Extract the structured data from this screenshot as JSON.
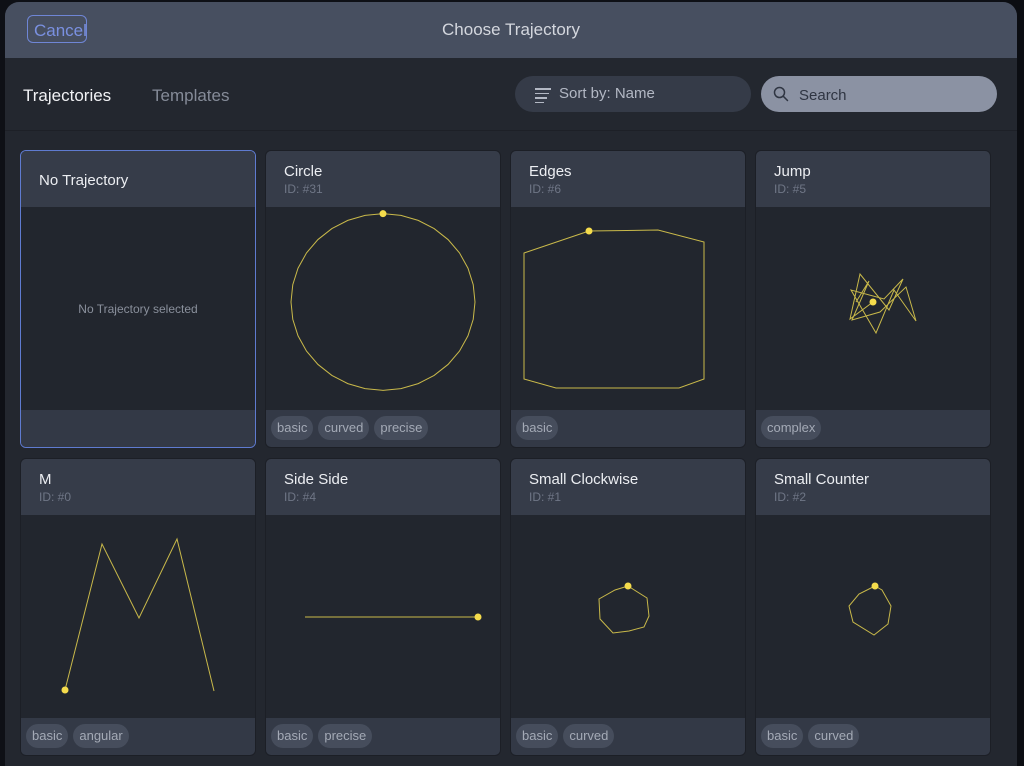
{
  "modal": {
    "title": "Choose Trajectory",
    "cancel_label": "Cancel"
  },
  "tabs": [
    {
      "label": "Trajectories",
      "active": true
    },
    {
      "label": "Templates",
      "active": false
    }
  ],
  "sort": {
    "icon": "sort-lines-icon",
    "label": "Sort by: Name"
  },
  "search": {
    "icon": "search-icon",
    "placeholder": "Search",
    "value": ""
  },
  "colors": {
    "accent": "#6f86d6",
    "trajectory_line": "#c9b94a",
    "trajectory_start": "#f5dc4c"
  },
  "cards": [
    {
      "name": "No Trajectory",
      "id": "",
      "selected": true,
      "empty_message": "No Trajectory selected",
      "tags": [],
      "shape": null
    },
    {
      "name": "Circle",
      "id": "ID: #31",
      "selected": false,
      "tags": [
        "basic",
        "curved",
        "precise"
      ],
      "shape": "circle"
    },
    {
      "name": "Edges",
      "id": "ID: #6",
      "selected": false,
      "tags": [
        "basic"
      ],
      "shape": "edges"
    },
    {
      "name": "Jump",
      "id": "ID: #5",
      "selected": false,
      "tags": [
        "complex"
      ],
      "shape": "jump"
    },
    {
      "name": "M",
      "id": "ID: #0",
      "selected": false,
      "tags": [
        "basic",
        "angular"
      ],
      "shape": "m"
    },
    {
      "name": "Side Side",
      "id": "ID: #4",
      "selected": false,
      "tags": [
        "basic",
        "precise"
      ],
      "shape": "side"
    },
    {
      "name": "Small Clockwise",
      "id": "ID: #1",
      "selected": false,
      "tags": [
        "basic",
        "curved"
      ],
      "shape": "small-cw"
    },
    {
      "name": "Small Counter",
      "id": "ID: #2",
      "selected": false,
      "tags": [
        "basic",
        "curved"
      ],
      "shape": "small-ccw"
    }
  ]
}
